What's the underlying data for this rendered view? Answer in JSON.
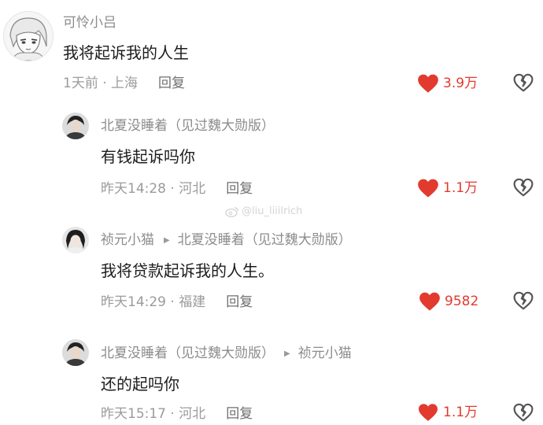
{
  "colors": {
    "like_red": "#e23a2e",
    "meta_gray": "#9b9b9b",
    "author_gray": "#8c8c8c"
  },
  "icons": {
    "like": "heart-icon",
    "dislike": "broken-heart-icon",
    "reply_arrow": "triangle-right-icon"
  },
  "watermark": {
    "text": "@liu_liiilrich"
  },
  "comments": [
    {
      "author": "可怜小吕",
      "content": "我将起诉我的人生",
      "time_location": "1天前 · 上海",
      "reply_label": "回复",
      "likes": "3.9万"
    },
    {
      "author": "北夏没睡着（见过魏大勋版）",
      "content": "有钱起诉吗你",
      "time_location": "昨天14:28 · 河北",
      "reply_label": "回复",
      "likes": "1.1万"
    },
    {
      "author": "祯元小猫",
      "reply_to": "北夏没睡着（见过魏大勋版）",
      "content": "我将贷款起诉我的人生。",
      "time_location": "昨天14:29 · 福建",
      "reply_label": "回复",
      "likes": "9582"
    },
    {
      "author": "北夏没睡着（见过魏大勋版）",
      "reply_to": "祯元小猫",
      "content": "还的起吗你",
      "time_location": "昨天15:17 · 河北",
      "reply_label": "回复",
      "likes": "1.1万"
    }
  ]
}
